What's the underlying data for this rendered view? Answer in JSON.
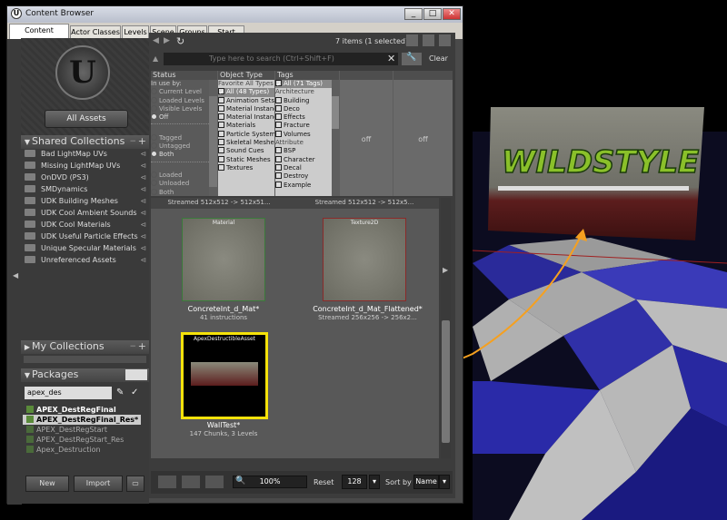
{
  "window": {
    "title": "Content Browser",
    "logo": "U",
    "controls": [
      "_",
      "□",
      "✕"
    ]
  },
  "tabs": [
    "Content Browser",
    "Actor Classes",
    "Levels",
    "Scene",
    "Groups",
    "Start Page"
  ],
  "toolbar": {
    "items_count": "7 items (1 selected)",
    "search_placeholder": "Type here to search (Ctrl+Shift+F)",
    "clear_label": "Clear"
  },
  "filters": {
    "status": {
      "header": "Status",
      "in_use_label": "In use by:",
      "in_use": [
        "Current Level",
        "Loaded Levels",
        "Visible Levels",
        "Off"
      ],
      "tagged": [
        "Tagged",
        "Untagged",
        "Both"
      ],
      "loaded": [
        "Loaded",
        "Unloaded",
        "Both"
      ]
    },
    "object_type": {
      "header": "Object Type",
      "favorites": "Favorite All Types",
      "all": "All (48 Types)",
      "items": [
        "Animation Sets",
        "Material Instances",
        "Material Instances",
        "Materials",
        "Particle Systems",
        "Skeletal Meshes",
        "Sound Cues",
        "Static Meshes",
        "Textures"
      ]
    },
    "tags": {
      "header": "Tags",
      "all": "All (71 Tags)",
      "group1": "Architecture",
      "items1": [
        "Building",
        "Deco",
        "Effects",
        "Fracture",
        "Volumes"
      ],
      "group2": "Attribute",
      "items2": [
        "BSP",
        "Character",
        "Decal",
        "Destroy",
        "Example"
      ]
    },
    "col4": "off",
    "col5": "off"
  },
  "shared_collections": {
    "title": "Shared Collections",
    "items": [
      "Bad LightMap UVs",
      "Missing LightMap UVs",
      "OnDVD (PS3)",
      "SMDynamics",
      "UDK Building Meshes",
      "UDK Cool Ambient Sounds",
      "UDK Cool Materials",
      "UDK Useful Particle Effects",
      "Unique Specular Materials",
      "Unreferenced Assets"
    ]
  },
  "my_collections": {
    "title": "My Collections"
  },
  "packages": {
    "title": "Packages",
    "filter_value": "apex_des",
    "items": [
      "APEX_DestRegFinal",
      "APEX_DestRegFinal_Res*",
      "APEX_DestRegStart",
      "APEX_DestRegStart_Res",
      "Apex_Destruction"
    ]
  },
  "left_buttons": {
    "all_assets": "All Assets",
    "new": "New",
    "import": "Import"
  },
  "assets": [
    {
      "type": "Material",
      "name": "ConcreteInt_d_Mat*",
      "info": "41 instructions"
    },
    {
      "type": "Texture2D",
      "name": "ConcreteInt_d_Mat_Flattened*",
      "info": "Streamed 256x256 -> 256x2..."
    },
    {
      "type": "ApexDestructibleAsset",
      "name": "WallTest*",
      "info": "147 Chunks, 3 Levels"
    }
  ],
  "top_row_info": [
    "Streamed 512x512 -> 512x51...",
    "Streamed 512x512 -> 512x5..."
  ],
  "bottom": {
    "zoom": "100%",
    "reset": "Reset",
    "size": "128",
    "sort_label": "Sort by",
    "sort_value": "Name"
  },
  "viewport": {
    "graffiti": "WILDSTYLE"
  },
  "colors": {
    "selection": "#f5e20a",
    "arrow": "#f5a020",
    "floor_blue": "#2a2aa0"
  }
}
